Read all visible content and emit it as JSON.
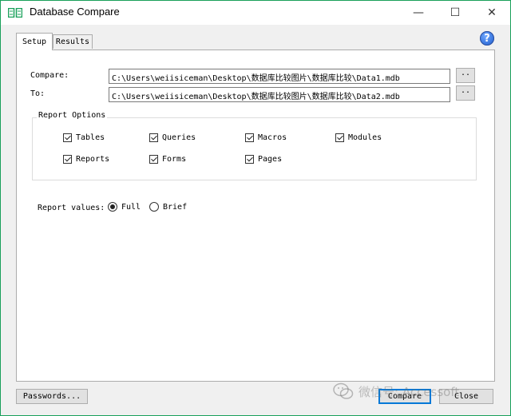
{
  "window": {
    "title": "Database Compare",
    "minimize": "—",
    "maximize": "☐",
    "close": "✕"
  },
  "tabs": [
    {
      "label": "Setup",
      "active": true
    },
    {
      "label": "Results",
      "active": false
    }
  ],
  "help": {
    "glyph": "?"
  },
  "compare": {
    "label": "Compare:",
    "value": "C:\\Users\\weiisiceman\\Desktop\\数据库比较图片\\数据库比较\\Data1.mdb",
    "browse": ".."
  },
  "to": {
    "label": "To:",
    "value": "C:\\Users\\weiisiceman\\Desktop\\数据库比较图片\\数据库比较\\Data2.mdb",
    "browse": ".."
  },
  "report_options": {
    "legend": "Report Options",
    "items": [
      {
        "label": "Tables",
        "checked": true
      },
      {
        "label": "Queries",
        "checked": true
      },
      {
        "label": "Macros",
        "checked": true
      },
      {
        "label": "Modules",
        "checked": true
      },
      {
        "label": "Reports",
        "checked": true
      },
      {
        "label": "Forms",
        "checked": true
      },
      {
        "label": "Pages",
        "checked": true
      }
    ]
  },
  "report_values": {
    "label": "Report values:",
    "options": [
      {
        "label": "Full",
        "selected": true
      },
      {
        "label": "Brief",
        "selected": false
      }
    ]
  },
  "buttons": {
    "passwords": "Passwords...",
    "compare": "Compare",
    "close": "Close"
  },
  "watermark": {
    "text": "微信号: Accessoft"
  },
  "colors": {
    "accent": "#19a05a",
    "focus": "#0078d7"
  }
}
